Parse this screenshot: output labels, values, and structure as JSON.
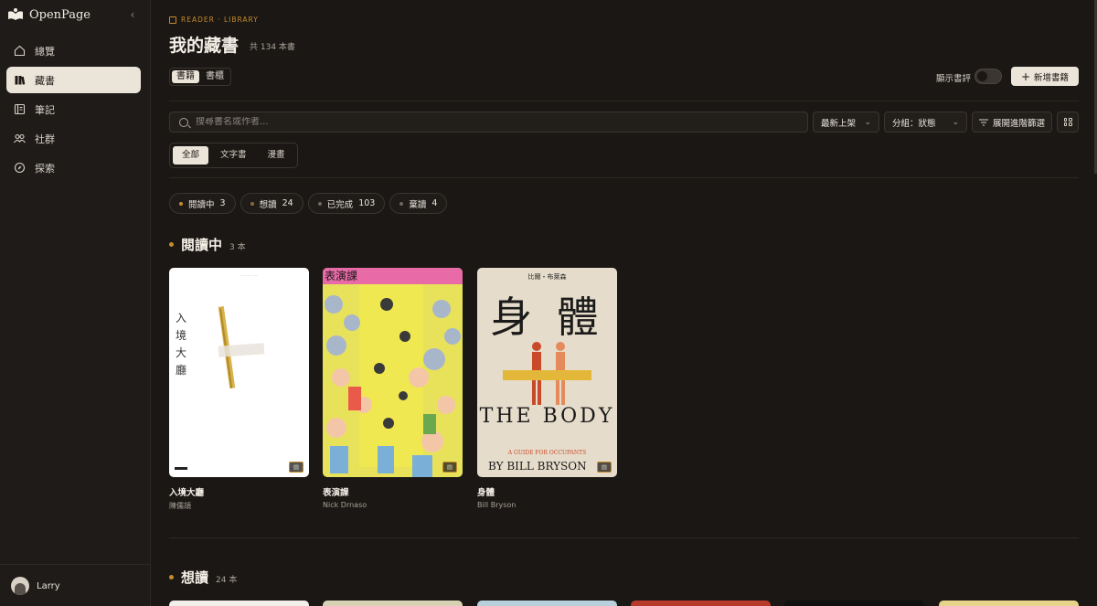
{
  "app": {
    "name": "OpenPage"
  },
  "sidebar": {
    "items": [
      {
        "label": "總覽",
        "icon": "home-icon",
        "active": false
      },
      {
        "label": "藏書",
        "icon": "books-icon",
        "active": true
      },
      {
        "label": "筆記",
        "icon": "notes-icon",
        "active": false
      },
      {
        "label": "社群",
        "icon": "community-icon",
        "active": false
      },
      {
        "label": "探索",
        "icon": "compass-icon",
        "active": false
      }
    ],
    "user": {
      "name": "Larry"
    }
  },
  "header": {
    "breadcrumb": "READER · LIBRARY",
    "title": "我的藏書",
    "subtitle": "共 134 本書",
    "view_tabs": [
      "書籍",
      "書櫃"
    ],
    "toggle_label": "顯示書評",
    "add_button": "新增書籍"
  },
  "toolbar": {
    "search_placeholder": "搜尋書名或作者...",
    "sort_label": "最新上架",
    "group_label": "分組：狀態",
    "filter_label": "展開進階篩選"
  },
  "type_tabs": [
    "全部",
    "文字書",
    "漫畫"
  ],
  "status_chips": [
    {
      "label": "閱讀中",
      "count": "3",
      "color": "#c58b2a"
    },
    {
      "label": "想讀",
      "count": "24",
      "color": "#8a6a3a"
    },
    {
      "label": "已完成",
      "count": "103",
      "color": "#6e6860"
    },
    {
      "label": "棄讀",
      "count": "4",
      "color": "#6e6860"
    }
  ],
  "sections": [
    {
      "title": "閱讀中",
      "count": "3 本",
      "books": [
        {
          "title": "入境大廳",
          "author": "陳儒頡",
          "cover_text": "入境大廳"
        },
        {
          "title": "表演課",
          "author": "Nick Drnaso",
          "cover_text": "表演課"
        },
        {
          "title": "身體",
          "author": "Bill Bryson",
          "cover_text_top": "比爾・布萊森",
          "cover_big": "身 體",
          "cover_en": "THE BODY",
          "cover_sub": "A GUIDE FOR OCCUPANTS",
          "cover_author": "BY BILL BRYSON"
        }
      ]
    },
    {
      "title": "想讀",
      "count": "24 本"
    }
  ],
  "colors": {
    "accent": "#c58b2a",
    "bg": "#1a1714",
    "sidebar_bg": "#1e1b18",
    "active_pill": "#ebe4d8"
  }
}
